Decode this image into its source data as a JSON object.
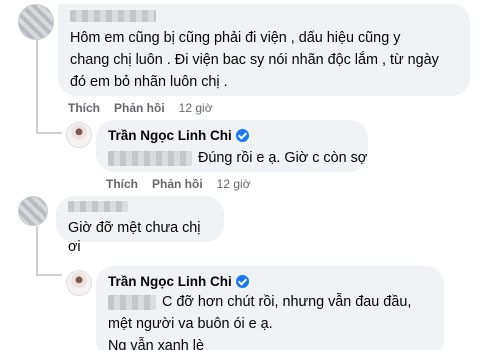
{
  "comments": [
    {
      "text_line1": "Hôm em cũng bị cũng phải đi viện , dấu hiệu cũng y",
      "text_line2": "chang chị luôn . Đi viện bac sy nói nhãn độc lắm , từ ngày",
      "text_line3": "đó em bỏ nhãn luôn chị .",
      "like_label": "Thích",
      "reply_label": "Phản hồi",
      "time": "12 giờ"
    },
    {
      "author": "Trần Ngọc Linh Chi",
      "text": "Đúng rồi e ạ. Giờ c còn sợ",
      "like_label": "Thích",
      "reply_label": "Phản hồi",
      "time": "12 giờ"
    },
    {
      "text": "Giờ đỡ mệt chưa chị ơi"
    },
    {
      "author": "Trần Ngọc Linh Chi",
      "text_line1": "C đỡ hơn chút rồi, nhưng vẫn đau đầu,",
      "text_line2": "mệt người va buôn ói e ạ.",
      "text_line3": "Ng vẫn xanh lè"
    }
  ],
  "icons": {
    "verified": "verified-badge-icon"
  },
  "colors": {
    "bubble": "#f0f2f5",
    "meta": "#65676b",
    "verified": "#1877f2"
  }
}
